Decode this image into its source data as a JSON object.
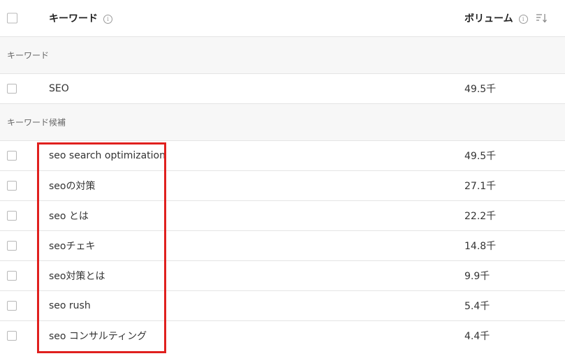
{
  "header": {
    "keyword_label": "キーワード",
    "volume_label": "ボリューム",
    "info_glyph": "i"
  },
  "sections": [
    {
      "label": "キーワード",
      "rows": [
        {
          "keyword": "SEO",
          "volume": "49.5千"
        }
      ]
    },
    {
      "label": "キーワード候補",
      "rows": [
        {
          "keyword": "seo search optimization",
          "volume": "49.5千"
        },
        {
          "keyword": "seoの対策",
          "volume": "27.1千"
        },
        {
          "keyword": "seo とは",
          "volume": "22.2千"
        },
        {
          "keyword": "seoチェキ",
          "volume": "14.8千"
        },
        {
          "keyword": "seo対策とは",
          "volume": "9.9千"
        },
        {
          "keyword": "seo rush",
          "volume": "5.4千"
        },
        {
          "keyword": "seo コンサルティング",
          "volume": "4.4千"
        }
      ]
    }
  ],
  "icons": {
    "info": "info-icon",
    "sort": "sort-descending-icon"
  },
  "colors": {
    "highlight_border": "#e0201e",
    "section_background": "#f7f7f7",
    "divider": "#e4e4e4"
  }
}
